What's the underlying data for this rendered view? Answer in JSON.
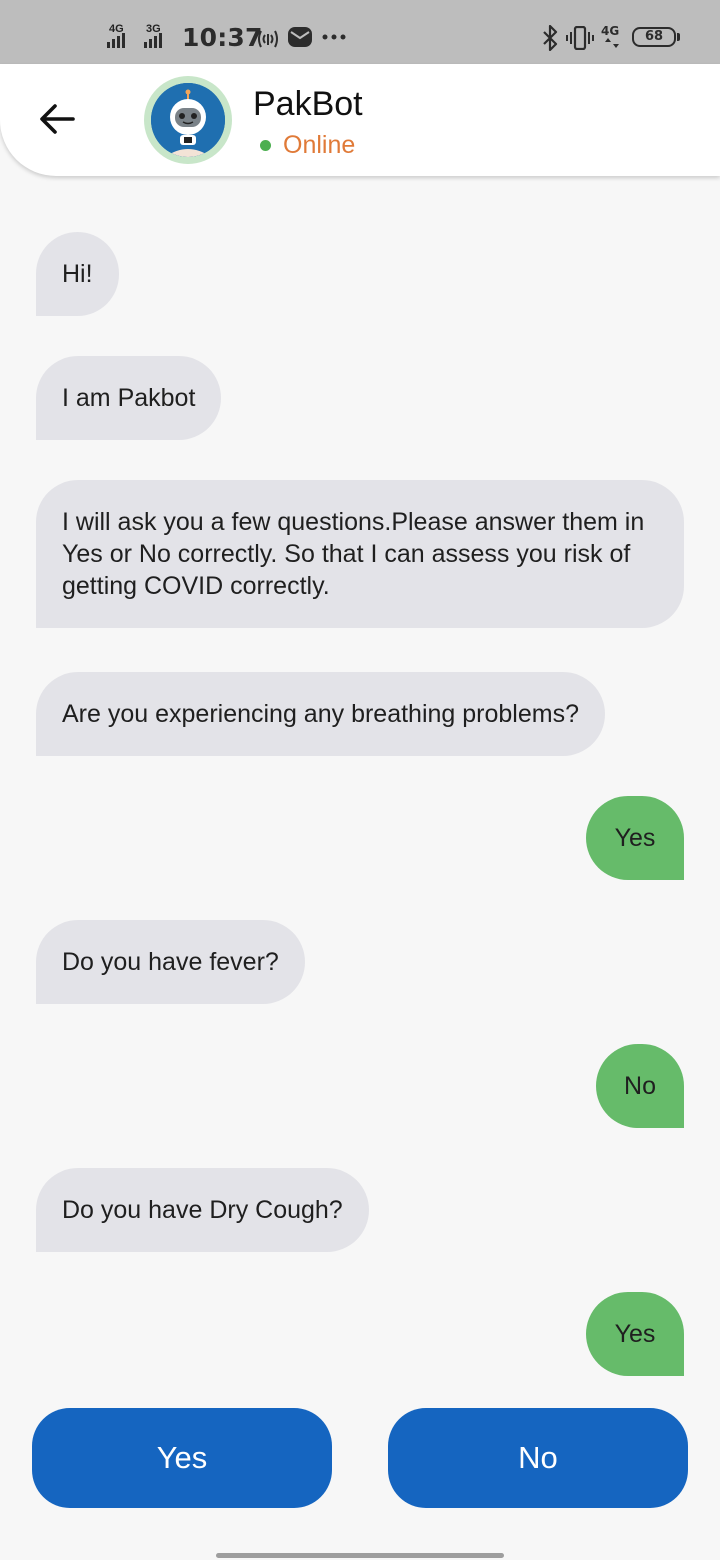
{
  "status_bar": {
    "network1": "4G",
    "network2": "3G",
    "time": "10:37",
    "network3": "4G",
    "battery": "68"
  },
  "app_bar": {
    "bot_name": "PakBot",
    "status": "Online",
    "status_color": "#e07a38",
    "online_dot_color": "#4caf50"
  },
  "messages": [
    {
      "from": "bot",
      "text": "Hi!"
    },
    {
      "from": "bot",
      "text": "I am Pakbot"
    },
    {
      "from": "bot",
      "text": "I will ask you a few questions.Please answer them in Yes or No correctly. So that I can assess you risk of getting COVID correctly."
    },
    {
      "from": "bot",
      "text": "Are you experiencing any breathing problems?"
    },
    {
      "from": "user",
      "text": "Yes"
    },
    {
      "from": "bot",
      "text": "Do you have fever?"
    },
    {
      "from": "user",
      "text": "No"
    },
    {
      "from": "bot",
      "text": "Do you have Dry Cough?"
    },
    {
      "from": "user",
      "text": "Yes"
    }
  ],
  "reply_buttons": {
    "yes_label": "Yes",
    "no_label": "No",
    "color": "#1565c0"
  },
  "colors": {
    "bot_bubble": "#e3e3e8",
    "user_bubble": "#66bb6a",
    "app_bar": "#ffffff",
    "status_bar": "#bdbdbd"
  }
}
